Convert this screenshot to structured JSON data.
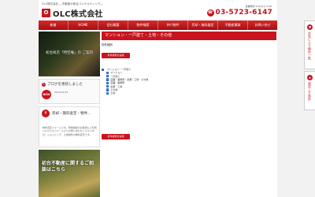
{
  "header": {
    "tagline": "OLC株式会社 ―不動産の総合コンサルティング―",
    "logo_mark": "O",
    "logo_text": "OLC株式会社",
    "hours": "営業時間 9:00から 9:00-",
    "phone": "03-5723-6147",
    "phone_icon": "phone-icon"
  },
  "nav": {
    "items": [
      "新着",
      "HOME",
      "会社概要",
      "物件検索",
      "仲介物件",
      "売却・無料査定",
      "不動産買取",
      "お問い合せ"
    ]
  },
  "sidebar": {
    "banner1_text": "初台商店「時空庵」の ご案内",
    "blog_title": "ブログを更新しました",
    "blog_new": "NEW",
    "blog_date": "2019/01/15",
    "sale_title": "売却・無料査定・物件...",
    "sale_desc": "物件査定フォームです。現地相談のお客様もご利用いただけるフォームよりお問い合わせくださいませ。ショッピング、土地物件の無料査定です。",
    "banner2_text": "初台不動産に関するご相談はこちら"
  },
  "main": {
    "title": "マンション・一戸建て・土地・その他",
    "category_label": "物件種別",
    "search_button": "条件検索を実施",
    "checkboxes": [
      {
        "label": "マンション・一戸建て",
        "checked": true,
        "indent": false
      },
      {
        "label": "マンション",
        "checked": true,
        "indent": true
      },
      {
        "label": "一戸建て",
        "checked": true,
        "indent": true
      },
      {
        "label": "店舗・事務所・倉庫・工場・その他",
        "checked": true,
        "indent": true
      },
      {
        "label": "店舗・事務所",
        "checked": true,
        "indent": true
      },
      {
        "label": "倉庫・工場",
        "checked": true,
        "indent": true
      },
      {
        "label": "その他",
        "checked": true,
        "indent": true
      },
      {
        "label": "土地",
        "checked": true,
        "indent": true
      }
    ]
  },
  "float_tabs": {
    "favorites": "お気に入り物件一覧",
    "saved": "保存した条件"
  },
  "colors": {
    "accent": "#c8141e",
    "checkbox": "#1a5fd1",
    "background": "#f2f2f2"
  }
}
